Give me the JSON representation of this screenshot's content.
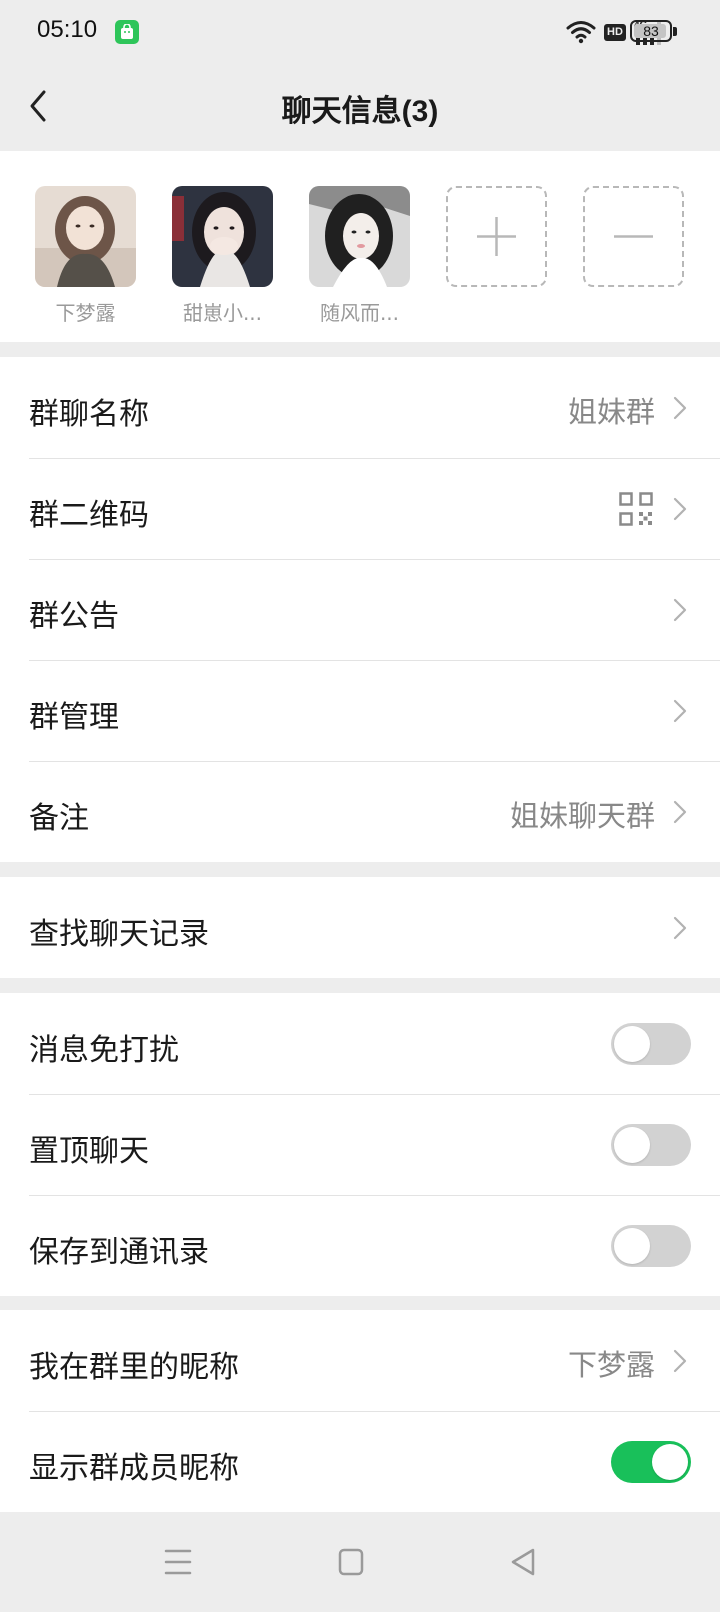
{
  "status_bar": {
    "time": "05:10",
    "notification_icon": "app-bag-icon",
    "wifi_icon": "wifi-icon",
    "hd_label": "HD",
    "network_label": "4G",
    "signal_icon": "signal-bars-icon",
    "battery_level": "83",
    "battery_fraction": 0.83
  },
  "nav": {
    "back_icon": "chevron-left-icon",
    "title": "聊天信息(3)"
  },
  "members": [
    {
      "name": "下梦露",
      "avatar": "photo-avatar"
    },
    {
      "name": "甜崽小...",
      "avatar": "photo-avatar"
    },
    {
      "name": "随风而...",
      "avatar": "photo-avatar"
    }
  ],
  "member_actions": {
    "add_icon": "plus-icon",
    "remove_icon": "minus-icon"
  },
  "group_info": [
    {
      "label": "群聊名称",
      "value": "姐妹群"
    },
    {
      "label": "群二维码",
      "value": "",
      "icon": "qr-code-icon"
    },
    {
      "label": "群公告",
      "value": ""
    },
    {
      "label": "群管理",
      "value": ""
    },
    {
      "label": "备注",
      "value": "姐妹聊天群"
    }
  ],
  "search": {
    "label": "查找聊天记录"
  },
  "switches": [
    {
      "label": "消息免打扰",
      "on": false
    },
    {
      "label": "置顶聊天",
      "on": false
    },
    {
      "label": "保存到通讯录",
      "on": false
    }
  ],
  "nickname": {
    "my_nickname_label": "我在群里的昵称",
    "my_nickname_value": "下梦露",
    "show_nickname_label": "显示群成员昵称",
    "show_nickname_on": true
  },
  "colors": {
    "accent_green": "#19c05a",
    "switch_off": "#d2d2d2",
    "background": "#ededed"
  },
  "system_nav": {
    "menu_icon": "menu-lines-icon",
    "home_icon": "square-home-icon",
    "back_icon": "triangle-back-icon"
  }
}
